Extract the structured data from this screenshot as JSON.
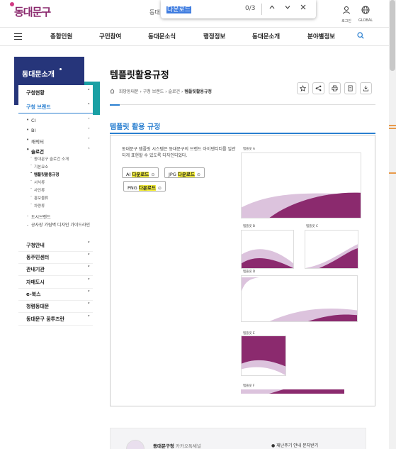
{
  "header": {
    "logo_text": "동대문구",
    "notice_text": "동대",
    "login_label": "로그인",
    "global_label": "GLOBAL"
  },
  "find_bar": {
    "query": "다운로드",
    "count": "0/3",
    "prev_icon": "chevron-up",
    "next_icon": "chevron-down",
    "close_icon": "close"
  },
  "gnb": {
    "items": [
      "종합민원",
      "구민참여",
      "동대문소식",
      "행정정보",
      "동대문소개",
      "분야별정보"
    ]
  },
  "sidebar": {
    "title": "동대문소개",
    "level1": [
      {
        "label": "구청현황",
        "chevron": "˅"
      },
      {
        "label": "구청 브랜드",
        "chevron": "˄"
      }
    ],
    "brand_items": [
      {
        "label": "CI",
        "chevron": "˅"
      },
      {
        "label": "BI",
        "chevron": "˅"
      },
      {
        "label": "캐릭터",
        "chevron": "˅"
      },
      {
        "label": "슬로건",
        "chevron": "˄"
      }
    ],
    "slogan_sub": [
      "동대문구 슬로건 소개",
      "기본요소",
      "템플릿활용규정",
      "서식류",
      "사인류",
      "홍보물류",
      "차량류"
    ],
    "other_brand": [
      "도시브랜드",
      "공사장 가림벽 디자인 가이드라인"
    ],
    "sections": [
      "구청안내",
      "동주민센터",
      "관내기관",
      "자매도시",
      "e-북스",
      "청렴동대문",
      "동대문구 꿈투즈란"
    ]
  },
  "page": {
    "title": "템플릿활용규정",
    "breadcrumb": [
      "희망동대문",
      "구청 브랜드",
      "슬로건",
      "템플릿활용규정"
    ],
    "section_title": "템플릿 활용 규정",
    "description": "동대문구 템플릿 시스템은 동대문구의 브랜드 아이덴티티를 일관되게 표현할 수 있도록 디자인되었다.",
    "downloads": [
      {
        "format": "AI",
        "label": "다운로드"
      },
      {
        "format": "JPG",
        "label": "다운로드"
      },
      {
        "format": "PNG",
        "label": "다운로드"
      }
    ],
    "templates": [
      {
        "label": "템플릿 A"
      },
      {
        "label": "템플릿 B"
      },
      {
        "label": "템플릿 C"
      },
      {
        "label": "템플릿 D"
      },
      {
        "label": "템플릿 E"
      },
      {
        "label": "템플릿 F"
      }
    ]
  },
  "footer": {
    "channel_name": "동대문구청",
    "channel_type": "카카오톡채널",
    "notice": "재난주기 안내 문자받기"
  },
  "colors": {
    "brand_purple": "#8b2a6e",
    "wave_light": "#dcc3dd",
    "accent_blue": "#2a7fd0",
    "sidebar_navy": "#26357a",
    "sidebar_teal": "#1aa0a4",
    "find_highlight": "#f6f03a"
  }
}
